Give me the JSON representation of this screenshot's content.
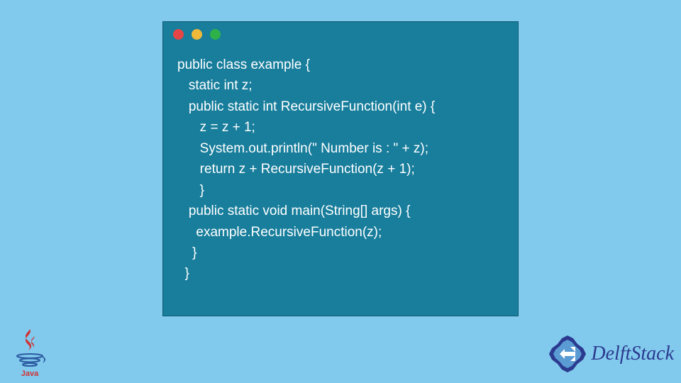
{
  "code": {
    "lines": [
      "public class example {",
      "   static int z;",
      "   public static int RecursiveFunction(int e) {",
      "      z = z + 1;",
      "      System.out.println(\" Number is : \" + z);",
      "      return z + RecursiveFunction(z + 1);",
      "      }",
      "   public static void main(String[] args) {",
      "     example.RecursiveFunction(z);",
      "    }",
      "  }"
    ]
  },
  "window": {
    "dot_colors": {
      "red": "#e64545",
      "yellow": "#f0b93a",
      "green": "#2fb14a"
    }
  },
  "logos": {
    "java": "Java",
    "delft": "DelftStack"
  }
}
